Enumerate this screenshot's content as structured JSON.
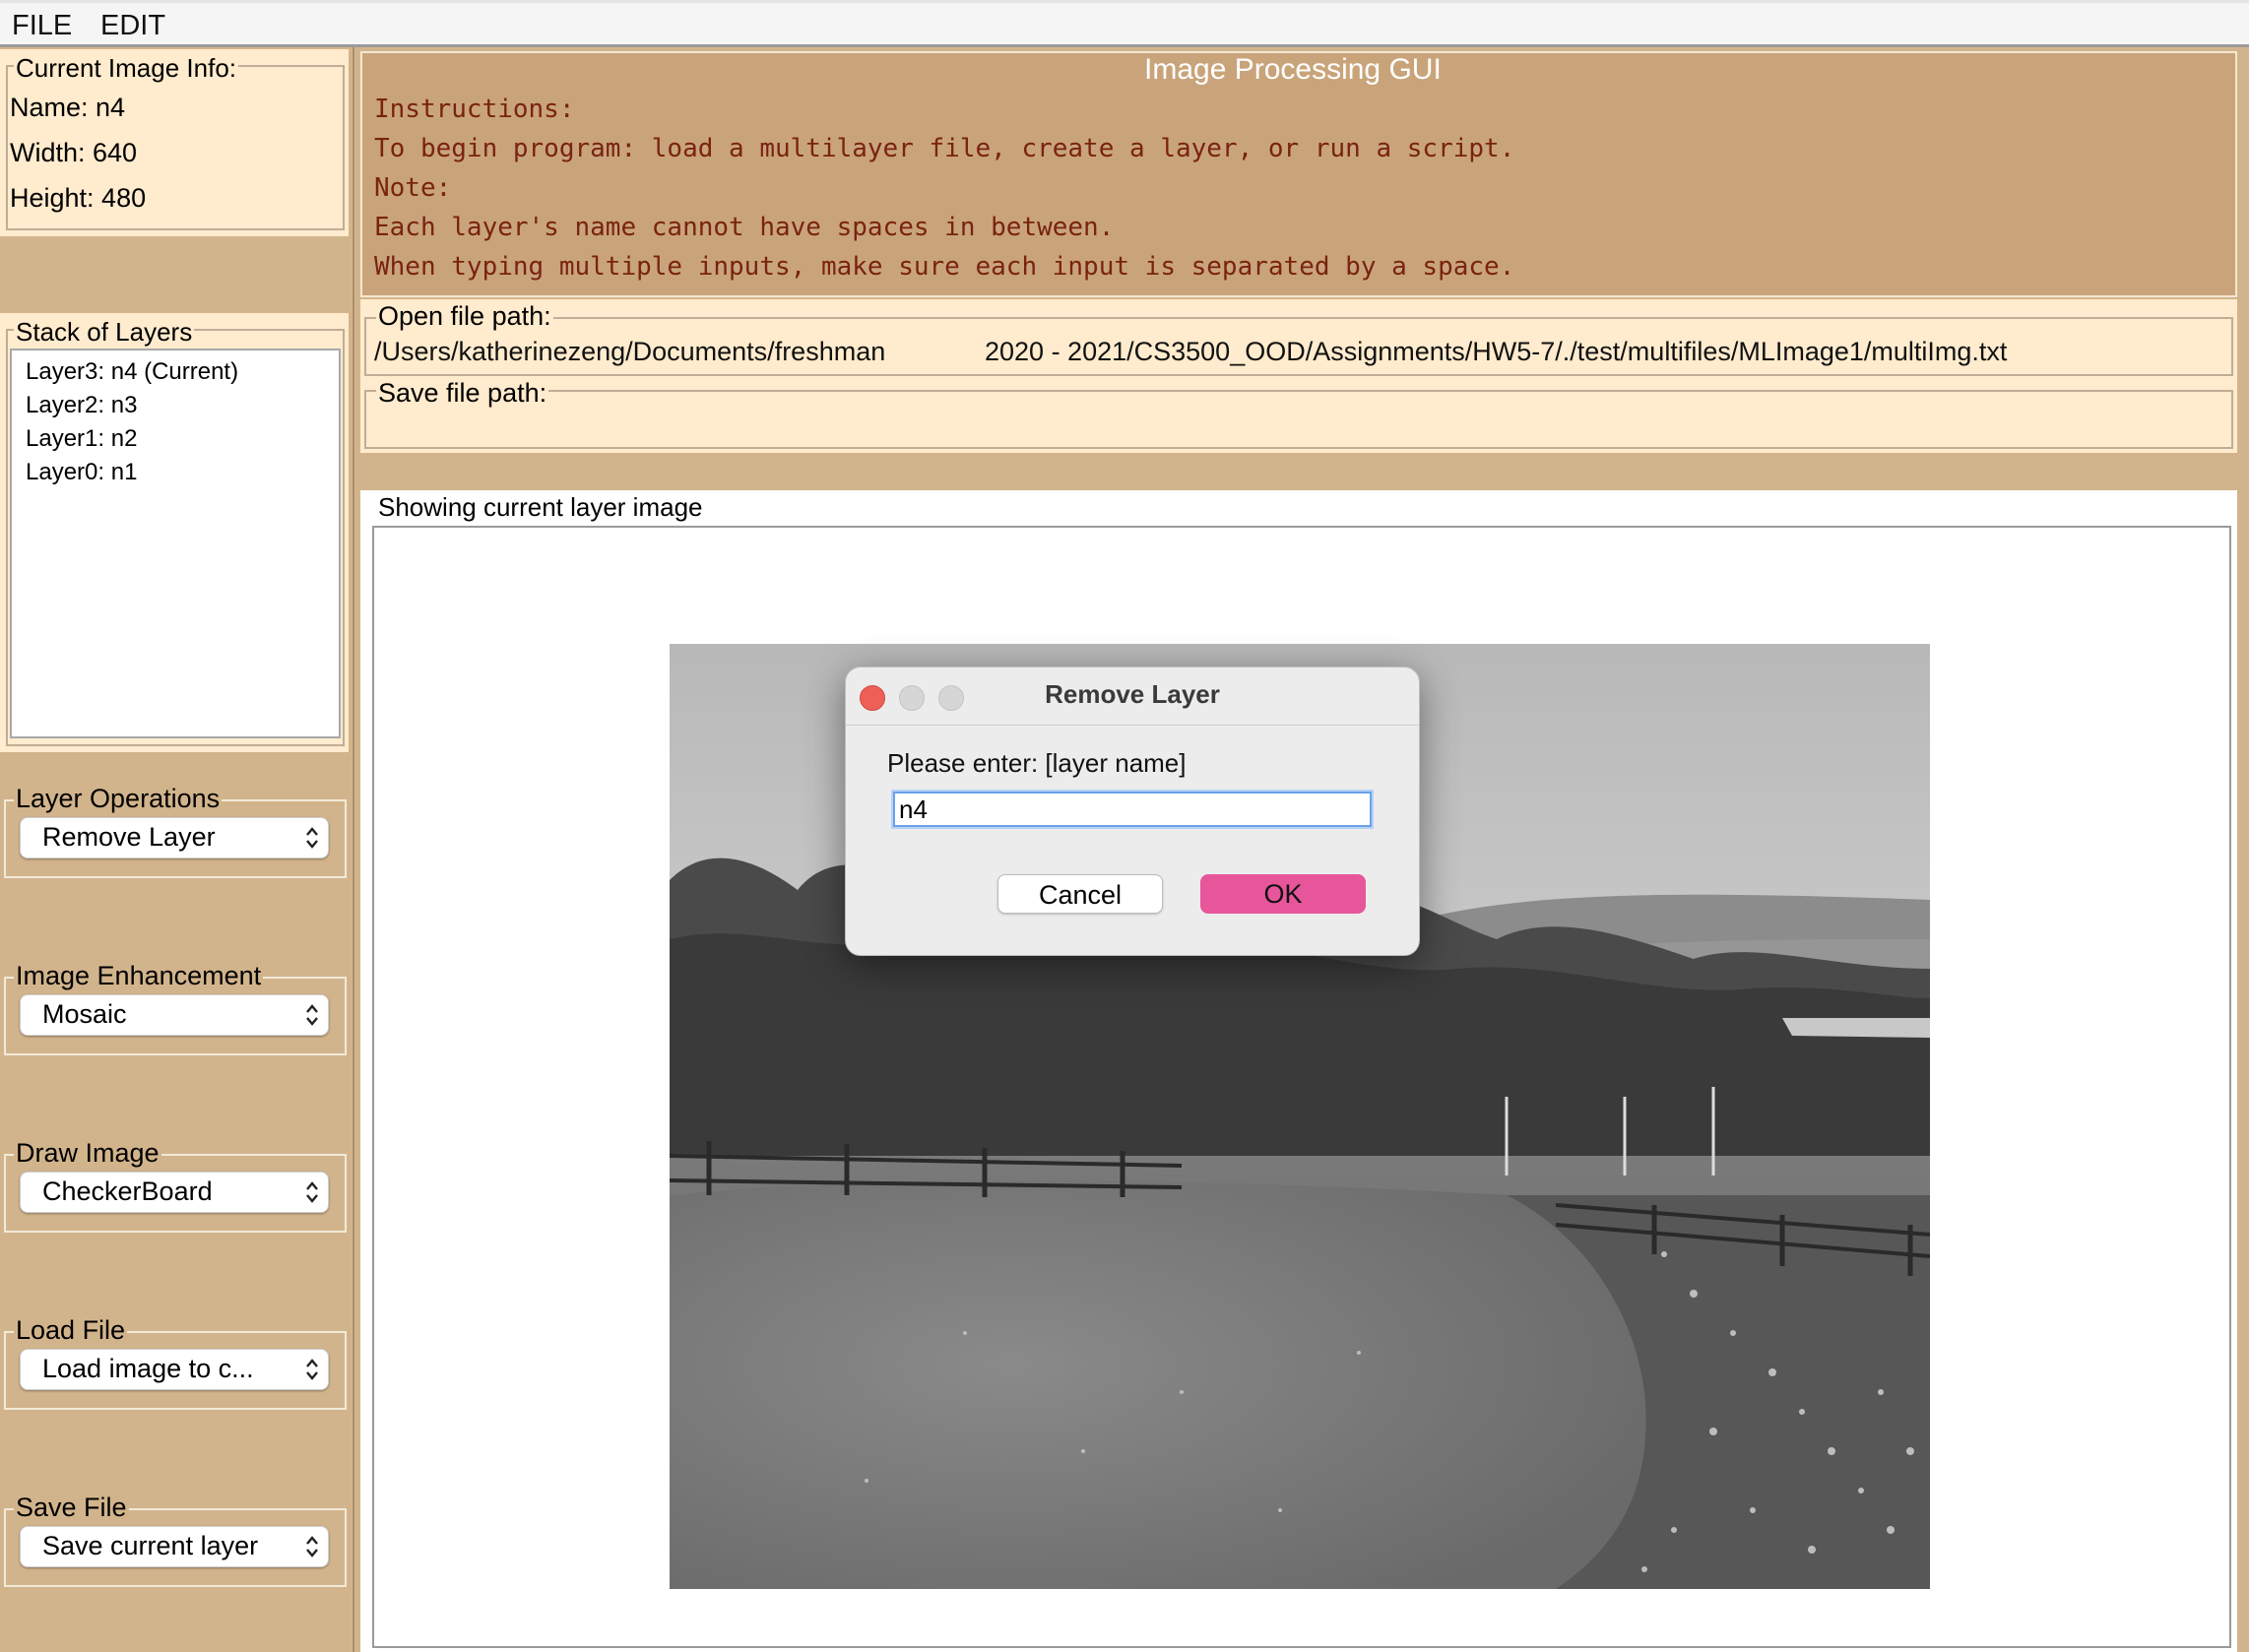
{
  "menu": {
    "file": "FILE",
    "edit": "EDIT"
  },
  "image_info": {
    "title": "Current Image Info:",
    "name": "Name: n4",
    "width": "Width: 640",
    "height": "Height: 480"
  },
  "layers": {
    "title": "Stack of Layers",
    "items": [
      "Layer3: n4 (Current)",
      "Layer2: n3",
      "Layer1: n2",
      "Layer0: n1"
    ]
  },
  "controls": {
    "layer_operations": {
      "title": "Layer Operations",
      "value": "Remove Layer"
    },
    "image_enhancement": {
      "title": "Image Enhancement",
      "value": "Mosaic"
    },
    "draw_image": {
      "title": "Draw Image",
      "value": "CheckerBoard"
    },
    "load_file": {
      "title": "Load File",
      "value": "Load image to c..."
    },
    "save_file": {
      "title": "Save File",
      "value": "Save current layer"
    }
  },
  "instructions": {
    "title": "Image Processing GUI",
    "lines": [
      "Instructions:",
      "To begin program: load a multilayer file, create a layer, or run a script.",
      "Note:",
      "Each layer's name cannot have spaces in between.",
      "When typing multiple inputs, make sure each input is separated by a space."
    ]
  },
  "files": {
    "open_title": "Open file path:",
    "open_path_part1": "/Users/katherinezeng/Documents/freshman",
    "open_path_part2": "2020 - 2021/CS3500_OOD/Assignments/HW5-7/./test/multifiles/MLImage1/multiImg.txt",
    "save_title": "Save file path:"
  },
  "image_panel": {
    "title": "Showing current layer image"
  },
  "dialog": {
    "title": "Remove Layer",
    "prompt": "Please enter: [layer name]",
    "input_value": "n4",
    "cancel": "Cancel",
    "ok": "OK"
  },
  "colors": {
    "tan": "#d2b48c",
    "cream": "#ffebcd",
    "instruction_text": "#7a2310",
    "ok_button": "#e7559a"
  }
}
